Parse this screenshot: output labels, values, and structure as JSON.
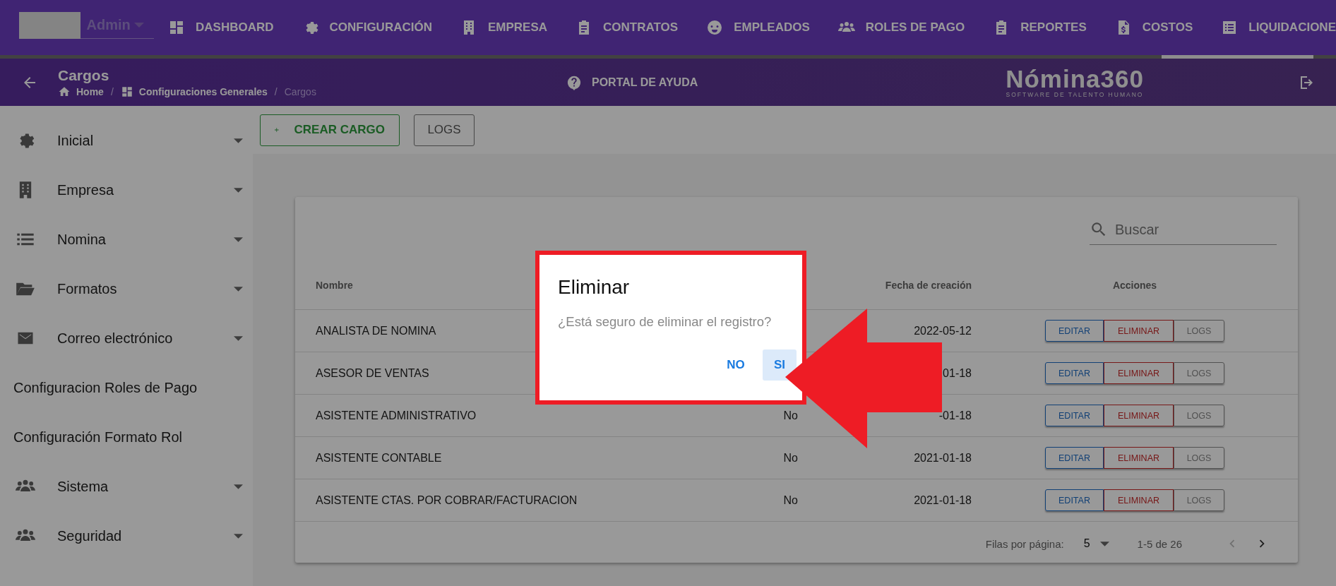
{
  "top_bar": {
    "user": {
      "name": "Admin"
    },
    "nav_items": [
      {
        "label": "DASHBOARD"
      },
      {
        "label": "CONFIGURACIÓN"
      },
      {
        "label": "EMPRESA"
      },
      {
        "label": "CONTRATOS"
      },
      {
        "label": "EMPLEADOS"
      },
      {
        "label": "ROLES DE PAGO"
      },
      {
        "label": "REPORTES"
      },
      {
        "label": "COSTOS"
      },
      {
        "label": "LIQUIDACIONE"
      }
    ]
  },
  "header": {
    "title": "Cargos",
    "breadcrumbs": [
      {
        "label": "Home",
        "current": false
      },
      {
        "separator": "/",
        "label": "Configuraciones Generales",
        "current": false
      },
      {
        "separator": "/",
        "label": "Cargos",
        "current": true
      }
    ],
    "help_link": "PORTAL DE AYUDA",
    "logo": {
      "name": "Nómina360",
      "tagline": "SOFTWARE DE TALENTO HUMANO"
    }
  },
  "sidebar": {
    "items": [
      {
        "label": "Inicial",
        "kind": "group"
      },
      {
        "label": "Empresa",
        "kind": "group"
      },
      {
        "label": "Nomina",
        "kind": "group"
      },
      {
        "label": "Formatos",
        "kind": "group"
      },
      {
        "label": "Correo electrónico",
        "kind": "group"
      },
      {
        "label": "Configuracion Roles de Pago",
        "kind": "link"
      },
      {
        "label": "Configuración Formato Rol",
        "kind": "link"
      },
      {
        "label": "Sistema",
        "kind": "group"
      },
      {
        "label": "Seguridad",
        "kind": "group"
      }
    ]
  },
  "toolbar": {
    "buttons": [
      {
        "label": "CREAR CARGO",
        "kind": "create"
      },
      {
        "label": "LOGS",
        "kind": "plain"
      }
    ]
  },
  "table": {
    "search": {
      "placeholder": "Buscar"
    },
    "columns": [
      "Nombre",
      "Fecha de creación",
      "Acciones"
    ],
    "rows": [
      {
        "name": "ANALISTA DE NOMINA",
        "date": "2022-05-12",
        "actions": [
          {
            "label": "EDITAR",
            "kind": "edit"
          },
          {
            "label": "ELIMINAR",
            "kind": "delete"
          },
          {
            "label": "LOGS",
            "kind": "logs"
          }
        ]
      },
      {
        "name": "ASESOR DE VENTAS",
        "date": "01-18",
        "actions": [
          {
            "label": "EDITAR",
            "kind": "edit"
          },
          {
            "label": "ELIMINAR",
            "kind": "delete"
          },
          {
            "label": "LOGS",
            "kind": "logs"
          }
        ]
      },
      {
        "name": "ASISTENTE ADMINISTRATIVO",
        "column_2": "No",
        "date": "-01-18",
        "actions": [
          {
            "label": "EDITAR",
            "kind": "edit"
          },
          {
            "label": "ELIMINAR",
            "kind": "delete"
          },
          {
            "label": "LOGS",
            "kind": "logs"
          }
        ]
      },
      {
        "name": "ASISTENTE CONTABLE",
        "column_2": "No",
        "date": "2021-01-18",
        "actions": [
          {
            "label": "EDITAR",
            "kind": "edit"
          },
          {
            "label": "ELIMINAR",
            "kind": "delete"
          },
          {
            "label": "LOGS",
            "kind": "logs"
          }
        ]
      },
      {
        "name": "ASISTENTE CTAS. POR COBRAR/FACTURACION",
        "column_2": "No",
        "date": "2021-01-18",
        "actions": [
          {
            "label": "EDITAR",
            "kind": "edit"
          },
          {
            "label": "ELIMINAR",
            "kind": "delete"
          },
          {
            "label": "LOGS",
            "kind": "logs"
          }
        ]
      }
    ],
    "pagination": {
      "rows_label": "Filas por página:",
      "rows_per_page": "5",
      "range": "1-5 de 26"
    }
  },
  "dialog": {
    "title": "Eliminar",
    "message": "¿Está seguro de eliminar el registro?",
    "buttons": [
      {
        "label": "NO",
        "selected": false
      },
      {
        "label": "SI",
        "selected": true
      }
    ]
  },
  "callout": {
    "highlight_box": true,
    "arrow": true
  }
}
